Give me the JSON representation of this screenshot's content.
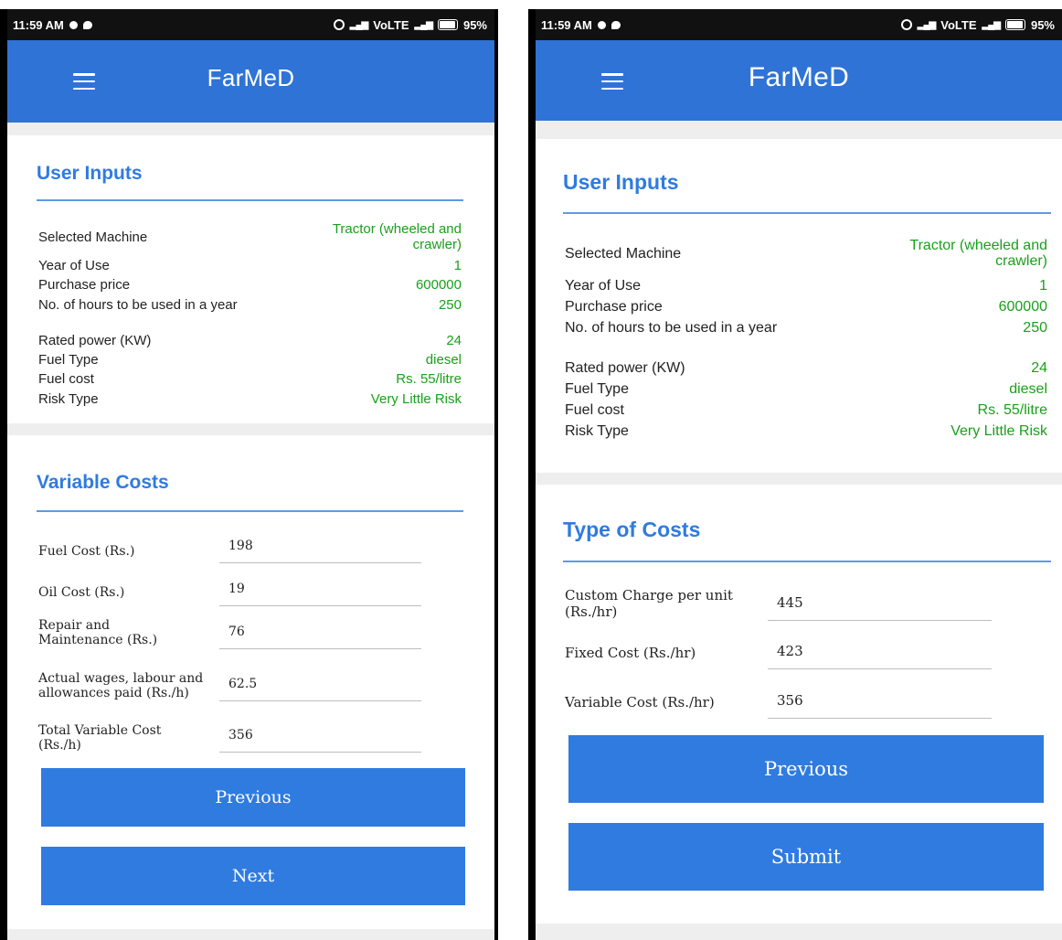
{
  "status_bar": {
    "time": "11:59 AM",
    "network": "VoLTE",
    "battery": "95%"
  },
  "app": {
    "title": "FarMeD"
  },
  "user_inputs": {
    "title": "User Inputs",
    "rows": [
      {
        "label": "Selected Machine",
        "value": "Tractor (wheeled and crawler)"
      },
      {
        "label": "Year of Use",
        "value": "1"
      },
      {
        "label": "Purchase price",
        "value": "600000"
      },
      {
        "label": "No. of hours to be used in a year",
        "value": "250"
      },
      {
        "label": "Rated power (KW)",
        "value": "24"
      },
      {
        "label": "Fuel Type",
        "value": "diesel"
      },
      {
        "label": "Fuel cost",
        "value": "Rs. 55/litre"
      },
      {
        "label": "Risk Type",
        "value": "Very Little Risk"
      }
    ]
  },
  "variable_costs": {
    "title": "Variable Costs",
    "fields": [
      {
        "label": "Fuel Cost (Rs.)",
        "value": "198"
      },
      {
        "label": "Oil Cost (Rs.)",
        "value": "19"
      },
      {
        "label": "Repair and Maintenance (Rs.)",
        "value": "76"
      },
      {
        "label": "Actual wages, labour and allowances paid (Rs./h)",
        "value": "62.5"
      },
      {
        "label": "Total Variable Cost (Rs./h)",
        "value": "356"
      }
    ],
    "previous_label": "Previous",
    "next_label": "Next"
  },
  "type_of_costs": {
    "title": "Type of Costs",
    "fields": [
      {
        "label": "Custom Charge per unit (Rs./hr)",
        "value": "445"
      },
      {
        "label": "Fixed Cost (Rs./hr)",
        "value": "423"
      },
      {
        "label": "Variable Cost (Rs./hr)",
        "value": "356"
      }
    ],
    "previous_label": "Previous",
    "submit_label": "Submit"
  },
  "colors": {
    "app_bar": "#2f73d6",
    "accent": "#2f7be0",
    "value_green": "#1aa01a"
  },
  "icons": [
    "menu-icon",
    "alarm-icon",
    "signal-icon",
    "battery-icon"
  ]
}
